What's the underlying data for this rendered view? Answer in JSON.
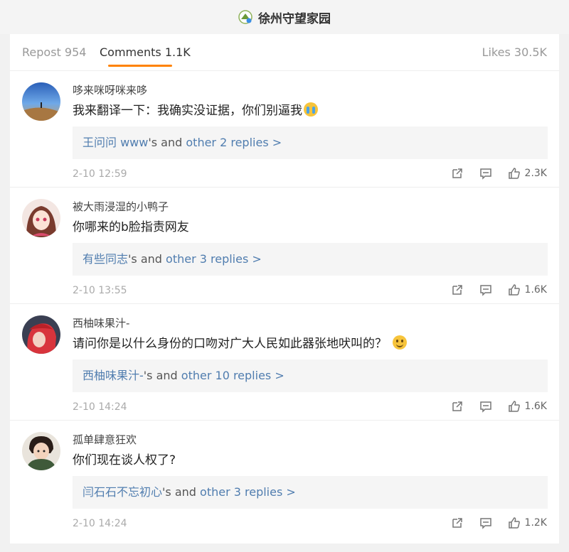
{
  "header": {
    "title": "徐州守望家园"
  },
  "tabs": {
    "repost": "Repost 954",
    "comments": "Comments 1.1K",
    "likes": "Likes 30.5K"
  },
  "comments": [
    {
      "username": "哆来咪呀咪来哆",
      "text": "我来翻译一下：我确实没证据，你们别逼我",
      "emoji": "crying-face",
      "reply_name": "王问问 www",
      "reply_suffix": "'s and ",
      "reply_more": "other 2 replies >",
      "time": "2-10 12:59",
      "likes": "2.3K"
    },
    {
      "username": "被大雨浸湿的小鸭子",
      "text": "你哪来的b脸指责网友",
      "emoji": "",
      "reply_name": "有些同志",
      "reply_suffix": "'s and ",
      "reply_more": "other 3 replies >",
      "time": "2-10 13:55",
      "likes": "1.6K"
    },
    {
      "username": "西柚味果汁-",
      "text": "请问你是以什么身份的口吻对广大人民如此器张地吠叫的？",
      "emoji": "smiling-face",
      "reply_name": "西柚味果汁-",
      "reply_suffix": "'s and ",
      "reply_more": "other 10 replies >",
      "time": "2-10 14:24",
      "likes": "1.6K"
    },
    {
      "username": "孤单肆意狂欢",
      "text": "你们现在谈人权了?",
      "emoji": "",
      "reply_name": "闫石石不忘初心",
      "reply_suffix": "'s and ",
      "reply_more": "other 3 replies >",
      "time": "2-10 14:24",
      "likes": "1.2K"
    }
  ],
  "colors": {
    "accent": "#ff8200",
    "link": "#507daf"
  },
  "icons": [
    "share-icon",
    "comment-icon",
    "like-icon"
  ]
}
